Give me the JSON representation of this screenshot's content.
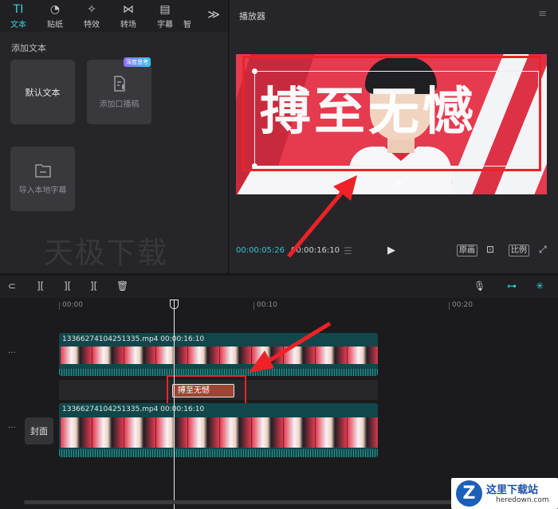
{
  "toolbar": {
    "tabs": [
      {
        "label": "文本",
        "glyph": "TI"
      },
      {
        "label": "贴纸",
        "glyph": "◔"
      },
      {
        "label": "特效",
        "glyph": "✧"
      },
      {
        "label": "转场",
        "glyph": "⋈"
      },
      {
        "label": "字幕",
        "glyph": "▤"
      },
      {
        "label": "智",
        "glyph": ""
      }
    ],
    "more": "≫"
  },
  "left_panel": {
    "section_title": "添加文本",
    "cards": [
      {
        "label": "默认文本"
      },
      {
        "label": "添加口播稿",
        "badge": "深度思考"
      },
      {
        "label": "导入本地字幕"
      }
    ],
    "watermark": "天极下载"
  },
  "player": {
    "title": "播放器",
    "menu": "≡",
    "overlay_text": "搏至无憾",
    "current_time": "00:00:05:26",
    "total_time": "00:00:16:10",
    "btn_original": "原画",
    "btn_ratio": "比例"
  },
  "timeline": {
    "ruler": [
      "00:00",
      "00:10",
      "00:20"
    ],
    "video_track": {
      "filename": "1336627410425​1335.mp4",
      "duration": "00:00:16:10"
    },
    "main_track": {
      "filename": "1336627410425​1335.mp4",
      "duration": "00:00:16:10"
    },
    "text_clip": "搏至无憾",
    "cover_label": "封面",
    "side_dots": "···"
  },
  "logo": {
    "letter": "Z",
    "title": "这里下载站",
    "domain": "heredown.com"
  },
  "colors": {
    "accent": "#3ed0d6",
    "annotation_red": "#ee2226",
    "track": "#11474a",
    "text_clip": "#9b4632"
  }
}
